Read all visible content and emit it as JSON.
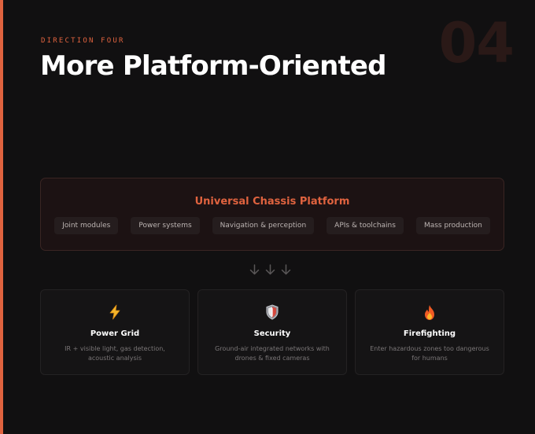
{
  "header": {
    "eyebrow": "DIRECTION FOUR",
    "number": "04",
    "title": "More Platform-Oriented"
  },
  "platform": {
    "title": "Universal Chassis Platform",
    "modules": [
      {
        "label": "Joint modules"
      },
      {
        "label": "Power systems"
      },
      {
        "label": "Navigation & perception"
      },
      {
        "label": "APIs & toolchains"
      },
      {
        "label": "Mass production"
      }
    ]
  },
  "arrows": [
    {
      "icon": "arrow-down-icon"
    },
    {
      "icon": "arrow-down-icon"
    },
    {
      "icon": "arrow-down-icon"
    }
  ],
  "applications": [
    {
      "icon": "lightning-icon",
      "title": "Power Grid",
      "description": "IR + visible light, gas detection, acoustic analysis"
    },
    {
      "icon": "shield-icon",
      "title": "Security",
      "description": "Ground-air integrated networks with drones & fixed cameras"
    },
    {
      "icon": "fire-icon",
      "title": "Firefighting",
      "description": "Enter hazardous zones too dangerous for humans"
    }
  ],
  "colors": {
    "accent": "#e0633f",
    "background": "#111011",
    "panel": "#1c1213"
  }
}
